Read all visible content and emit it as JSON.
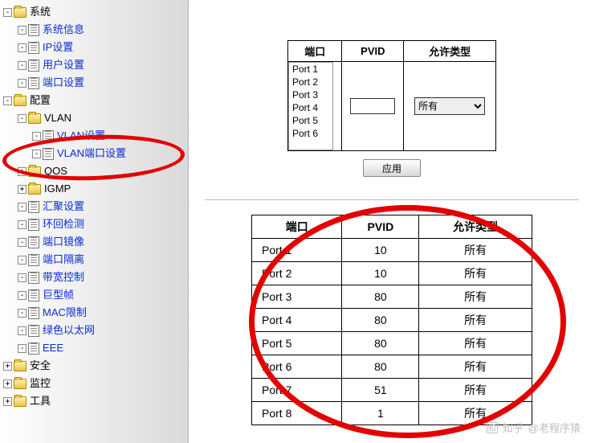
{
  "sidebar": {
    "items": [
      {
        "level": 0,
        "exp": "-",
        "icon": "folder",
        "label": "系统",
        "link": false,
        "name": "nav-system",
        "interact": true
      },
      {
        "level": 1,
        "exp": "-",
        "icon": "page",
        "label": "系统信息",
        "link": true,
        "name": "nav-system-info",
        "interact": true
      },
      {
        "level": 1,
        "exp": "-",
        "icon": "page",
        "label": "IP设置",
        "link": true,
        "name": "nav-ip-settings",
        "interact": true
      },
      {
        "level": 1,
        "exp": "-",
        "icon": "page",
        "label": "用户设置",
        "link": true,
        "name": "nav-user-settings",
        "interact": true
      },
      {
        "level": 1,
        "exp": "-",
        "icon": "page",
        "label": "端口设置",
        "link": true,
        "name": "nav-port-settings",
        "interact": true
      },
      {
        "level": 0,
        "exp": "-",
        "icon": "folder",
        "label": "配置",
        "link": false,
        "name": "nav-config",
        "interact": true
      },
      {
        "level": 1,
        "exp": "-",
        "icon": "folder",
        "label": "VLAN",
        "link": false,
        "name": "nav-vlan",
        "interact": true
      },
      {
        "level": 2,
        "exp": "-",
        "icon": "page",
        "label": "VLAN设置",
        "link": true,
        "name": "nav-vlan-settings",
        "interact": true
      },
      {
        "level": 2,
        "exp": "-",
        "icon": "page",
        "label": "VLAN端口设置",
        "link": true,
        "name": "nav-vlan-port-settings",
        "interact": true
      },
      {
        "level": 1,
        "exp": "+",
        "icon": "folder",
        "label": "QOS",
        "link": false,
        "name": "nav-qos",
        "interact": true
      },
      {
        "level": 1,
        "exp": "+",
        "icon": "folder",
        "label": "IGMP",
        "link": false,
        "name": "nav-igmp",
        "interact": true
      },
      {
        "level": 1,
        "exp": "-",
        "icon": "page",
        "label": "汇聚设置",
        "link": true,
        "name": "nav-trunk-settings",
        "interact": true
      },
      {
        "level": 1,
        "exp": "-",
        "icon": "page",
        "label": "环回检测",
        "link": true,
        "name": "nav-loop-detect",
        "interact": true
      },
      {
        "level": 1,
        "exp": "-",
        "icon": "page",
        "label": "端口镜像",
        "link": true,
        "name": "nav-port-mirror",
        "interact": true
      },
      {
        "level": 1,
        "exp": "-",
        "icon": "page",
        "label": "端口隔离",
        "link": true,
        "name": "nav-port-isolation",
        "interact": true
      },
      {
        "level": 1,
        "exp": "-",
        "icon": "page",
        "label": "带宽控制",
        "link": true,
        "name": "nav-bandwidth-control",
        "interact": true
      },
      {
        "level": 1,
        "exp": "-",
        "icon": "page",
        "label": "巨型帧",
        "link": true,
        "name": "nav-jumbo-frame",
        "interact": true
      },
      {
        "level": 1,
        "exp": "-",
        "icon": "page",
        "label": "MAC限制",
        "link": true,
        "name": "nav-mac-limit",
        "interact": true
      },
      {
        "level": 1,
        "exp": "-",
        "icon": "page",
        "label": "绿色以太网",
        "link": true,
        "name": "nav-green-ethernet",
        "interact": true
      },
      {
        "level": 1,
        "exp": "-",
        "icon": "page",
        "label": "EEE",
        "link": true,
        "name": "nav-eee",
        "interact": true
      },
      {
        "level": 0,
        "exp": "+",
        "icon": "folder",
        "label": "安全",
        "link": false,
        "name": "nav-security",
        "interact": true
      },
      {
        "level": 0,
        "exp": "+",
        "icon": "folder",
        "label": "监控",
        "link": false,
        "name": "nav-monitor",
        "interact": true
      },
      {
        "level": 0,
        "exp": "+",
        "icon": "folder",
        "label": "工具",
        "link": false,
        "name": "nav-tools",
        "interact": true
      }
    ]
  },
  "form": {
    "headers": {
      "port": "端口",
      "pvid": "PVID",
      "type": "允许类型"
    },
    "port_list": [
      "Port 1",
      "Port 2",
      "Port 3",
      "Port 4",
      "Port 5",
      "Port 6"
    ],
    "pvid_value": "",
    "type_value": "所有",
    "apply_label": "应用"
  },
  "table": {
    "headers": {
      "port": "端口",
      "pvid": "PVID",
      "type": "允许类型"
    },
    "rows": [
      {
        "port": "Port 1",
        "pvid": "10",
        "type": "所有"
      },
      {
        "port": "Port 2",
        "pvid": "10",
        "type": "所有"
      },
      {
        "port": "Port 3",
        "pvid": "80",
        "type": "所有"
      },
      {
        "port": "Port 4",
        "pvid": "80",
        "type": "所有"
      },
      {
        "port": "Port 5",
        "pvid": "80",
        "type": "所有"
      },
      {
        "port": "Port 6",
        "pvid": "80",
        "type": "所有"
      },
      {
        "port": "Port 7",
        "pvid": "51",
        "type": "所有"
      },
      {
        "port": "Port 8",
        "pvid": "1",
        "type": "所有"
      }
    ]
  },
  "watermark": {
    "brand": "知乎",
    "author": "@老程序猿"
  }
}
